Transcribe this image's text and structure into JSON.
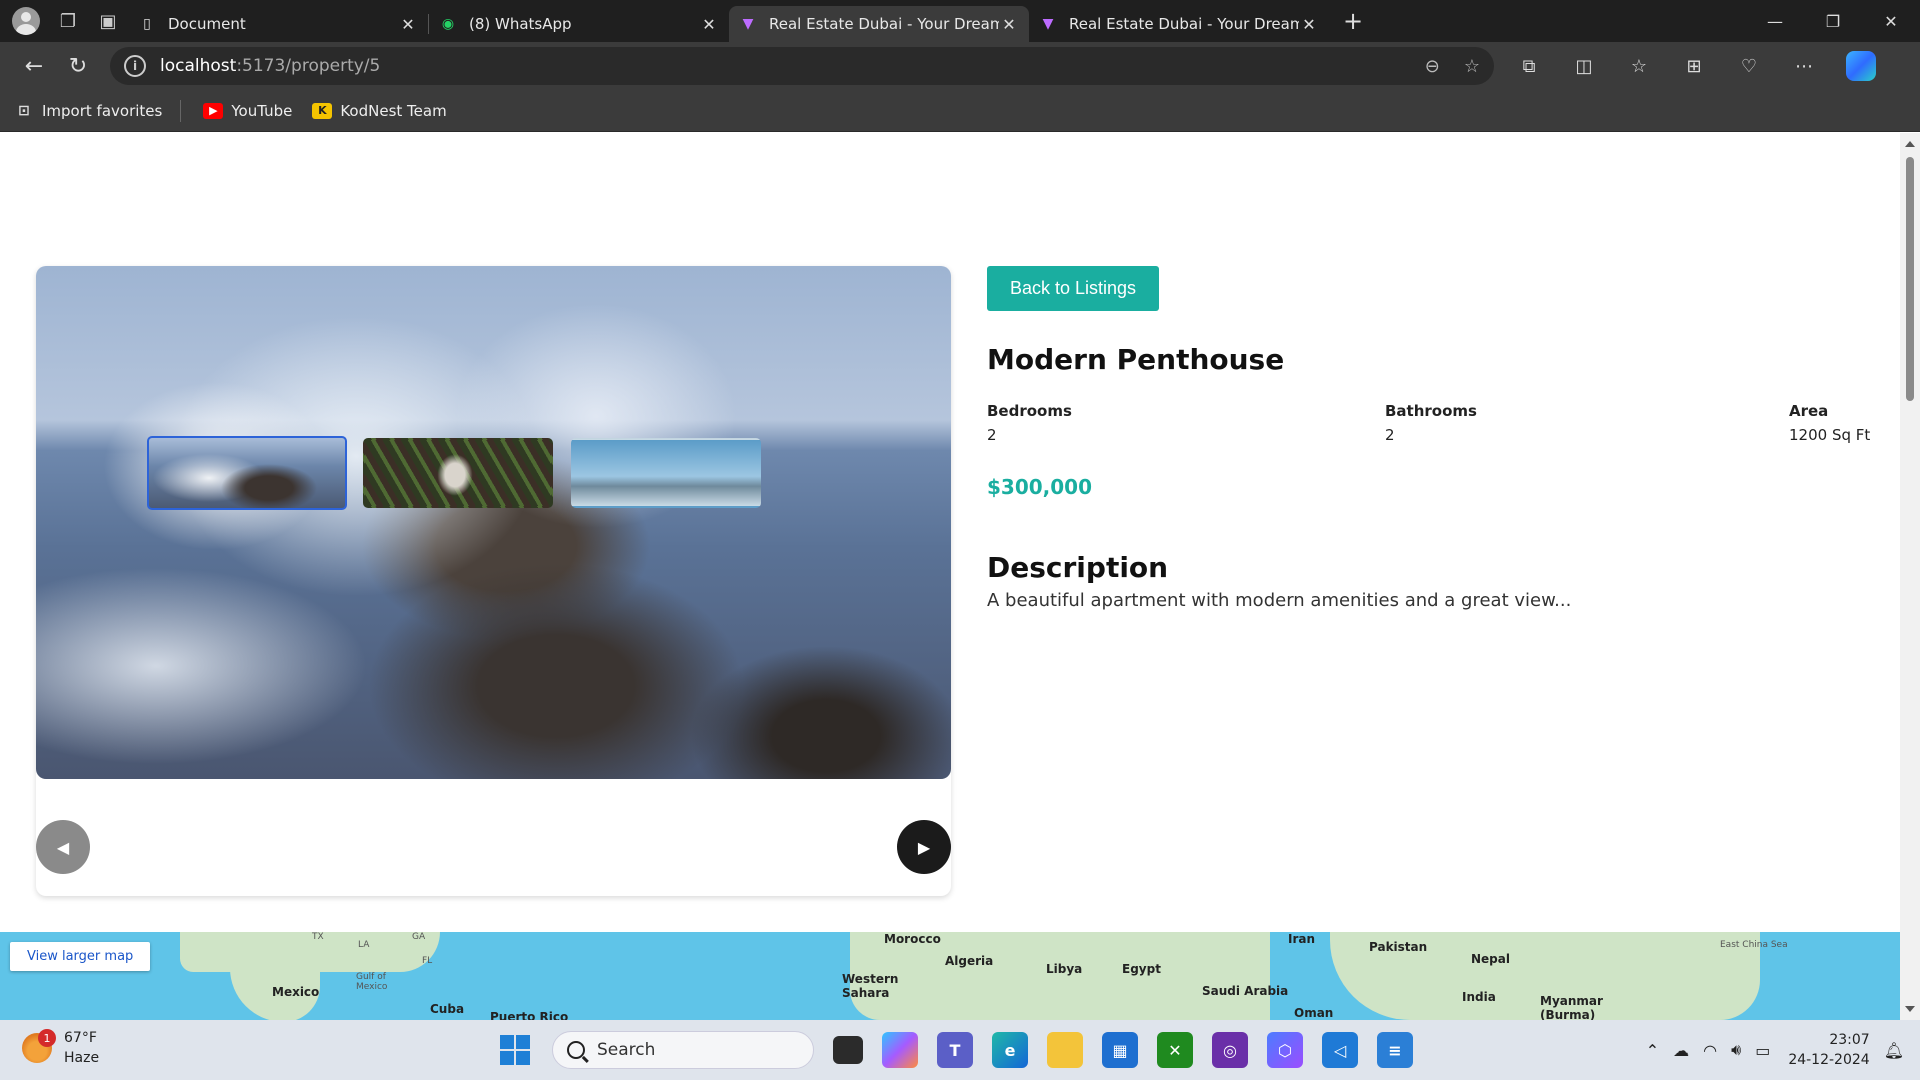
{
  "browser": {
    "tabs": [
      {
        "title": "Document",
        "active": false
      },
      {
        "title": "(8) WhatsApp",
        "active": false
      },
      {
        "title": "Real Estate Dubai - Your Dream Pr",
        "active": true
      },
      {
        "title": "Real Estate Dubai - Your Dream Pr",
        "active": false
      }
    ],
    "url_host": "localhost",
    "url_path": ":5173/property/5",
    "favorites": [
      {
        "label": "Import favorites"
      },
      {
        "label": "YouTube"
      },
      {
        "label": "KodNest Team"
      }
    ]
  },
  "property": {
    "back_label": "Back to Listings",
    "title": "Modern Penthouse",
    "specs": {
      "bedrooms_label": "Bedrooms",
      "bedrooms": "2",
      "bathrooms_label": "Bathrooms",
      "bathrooms": "2",
      "area_label": "Area",
      "area": "1200 Sq Ft"
    },
    "price": "$300,000",
    "description_heading": "Description",
    "description": "A beautiful apartment with modern amenities and a great view..."
  },
  "map": {
    "button_label": "View larger map",
    "labels": [
      "Mexico",
      "Gulf of Mexico",
      "Cuba",
      "Puerto Rico",
      "Morocco",
      "Algeria",
      "Libya",
      "Egypt",
      "Western Sahara",
      "Saudi Arabia",
      "Oman",
      "Iran",
      "Pakistan",
      "Nepal",
      "India",
      "Myanmar (Burma)",
      "East China Sea",
      "TX",
      "LA",
      "GA",
      "FL"
    ]
  },
  "taskbar": {
    "weather_temp": "67°F",
    "weather_desc": "Haze",
    "weather_badge": "1",
    "search_label": "Search",
    "time": "23:07",
    "date": "24-12-2024"
  }
}
